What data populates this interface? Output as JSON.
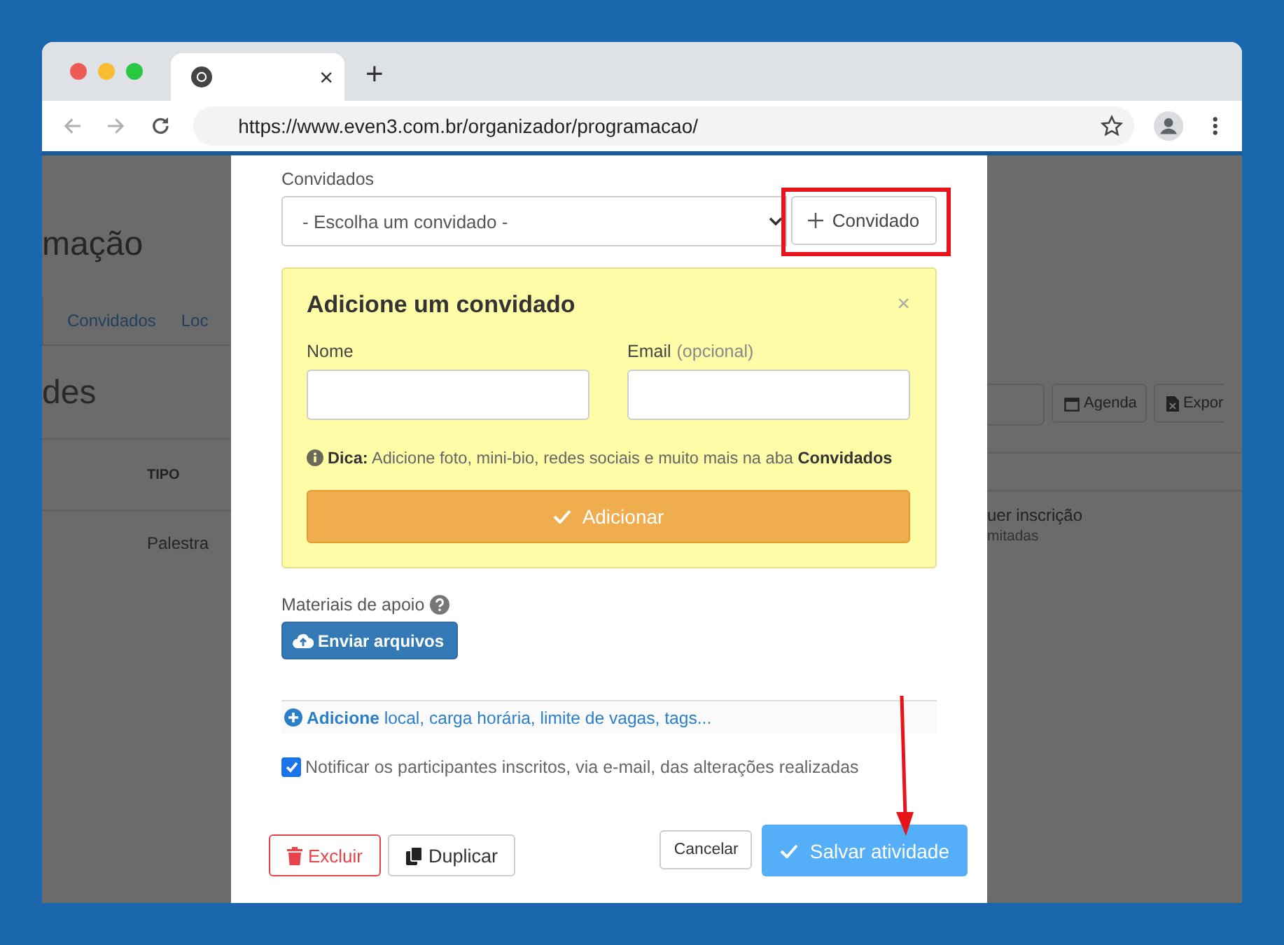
{
  "browser": {
    "tab": {
      "close": "×"
    },
    "new_tab": "+",
    "url": "https://www.even3.com.br/organizador/programacao/"
  },
  "background_page": {
    "heading": "mação",
    "tabs": [
      {
        "label": "Convidados",
        "selected": false
      },
      {
        "label": "Loc",
        "selected": false
      }
    ],
    "section_title": "des",
    "toolbar": [
      "Agenda",
      "Expor"
    ],
    "table": {
      "columns": [
        "TIPO"
      ],
      "rows": [
        [
          "Palestra"
        ]
      ]
    },
    "right_texts": [
      "uer inscrição",
      "mitadas"
    ]
  },
  "modal": {
    "guests_label": "Convidados",
    "guest_select": {
      "placeholder": "- Escolha um convidado -"
    },
    "add_guest_button": "Convidado",
    "add_guest_panel": {
      "title": "Adicione um convidado",
      "close": "×",
      "fields": [
        {
          "label": "Nome"
        },
        {
          "label": "Email",
          "hint": "(opcional)"
        }
      ],
      "tip": "**Dica:** Adicione foto, mini-bio, redes sociais e muito mais na aba **Convidados**",
      "submit": "Adicionar"
    },
    "materials_label": "Materiais de apoio",
    "upload_button": "Enviar arquivos",
    "more_link": "**Adicione** local, carga horária, limite de vagas, tags...",
    "notify": {
      "label": "Notificar os participantes inscritos, via e-mail, das alterações realizadas",
      "checked": true
    },
    "buttons": [
      {
        "label": "Excluir",
        "kind": "delete"
      },
      {
        "label": "Duplicar",
        "kind": "duplicate"
      },
      {
        "label": "Cancelar",
        "kind": "cancel"
      },
      {
        "label": "Salvar atividade",
        "kind": "save"
      }
    ]
  },
  "annotations": {
    "highlight_box": true,
    "arrow": true
  }
}
